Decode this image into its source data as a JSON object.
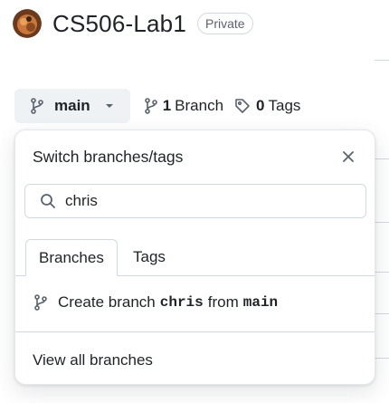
{
  "repo": {
    "name": "CS506-Lab1",
    "visibility": "Private"
  },
  "branch_bar": {
    "current_branch": "main",
    "branch_count": "1",
    "branch_label": "Branch",
    "tag_count": "0",
    "tag_label": "Tags"
  },
  "popover": {
    "title": "Switch branches/tags",
    "search_value": "chris",
    "tabs": [
      {
        "label": "Branches"
      },
      {
        "label": "Tags"
      }
    ],
    "create": {
      "prefix": "Create branch",
      "branch_name": "chris",
      "middle": "from",
      "source": "main"
    },
    "view_all": "View all branches"
  },
  "colors": {
    "text": "#1f2328",
    "muted": "#59636e",
    "border": "#d1d9e0",
    "button_bg": "#eff2f5"
  },
  "icons": [
    "avatar",
    "git-branch-icon",
    "chevron-down-icon",
    "tag-icon",
    "close-icon",
    "search-icon"
  ]
}
